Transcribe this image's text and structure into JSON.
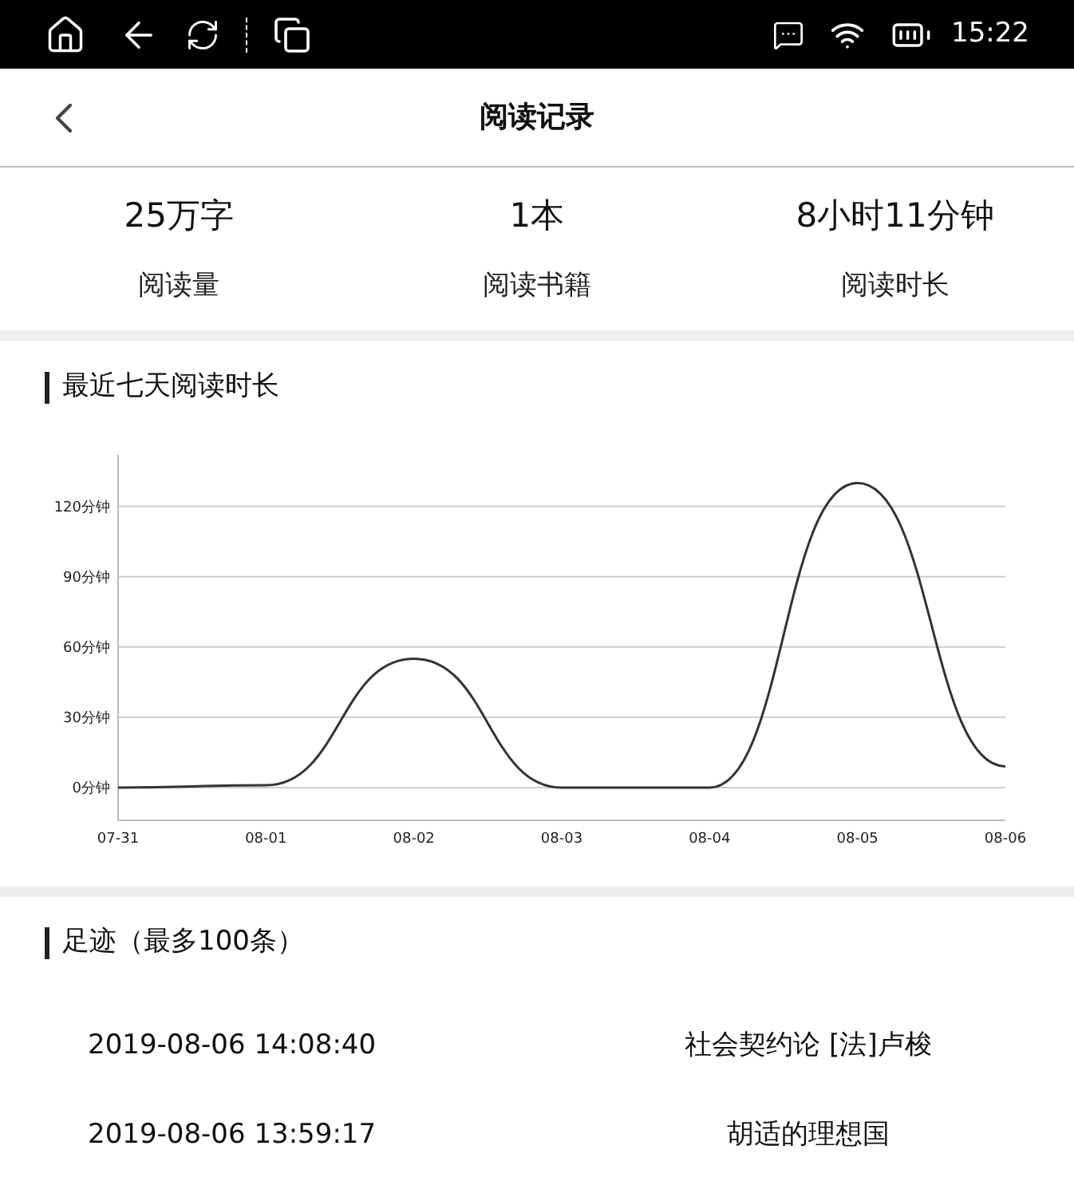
{
  "status_bar": {
    "time": "15:22"
  },
  "header": {
    "title": "阅读记录"
  },
  "stats": [
    {
      "value": "25万字",
      "label": "阅读量"
    },
    {
      "value": "1本",
      "label": "阅读书籍"
    },
    {
      "value": "8小时11分钟",
      "label": "阅读时长"
    }
  ],
  "chart_section": {
    "title": "最近七天阅读时长",
    "chart_data": {
      "type": "line",
      "categories": [
        "07-31",
        "08-01",
        "08-02",
        "08-03",
        "08-04",
        "08-05",
        "08-06"
      ],
      "grid": true,
      "series": [
        {
          "color": "#333333",
          "values": [
            0,
            1,
            55,
            0,
            0,
            130,
            9
          ]
        }
      ],
      "ylim": [
        -14,
        142
      ],
      "yticks": [
        {
          "value": 0,
          "label": "0分钟"
        },
        {
          "value": 30,
          "label": "30分钟"
        },
        {
          "value": 60,
          "label": "60分钟"
        },
        {
          "value": 90,
          "label": "90分钟"
        },
        {
          "value": 120,
          "label": "120分钟"
        }
      ]
    }
  },
  "history_section": {
    "title": "足迹（最多100条）",
    "rows": [
      {
        "time": "2019-08-06 14:08:40",
        "book": "社会契约论 [法]卢梭"
      },
      {
        "time": "2019-08-06 13:59:17",
        "book": "胡适的理想国"
      }
    ]
  }
}
